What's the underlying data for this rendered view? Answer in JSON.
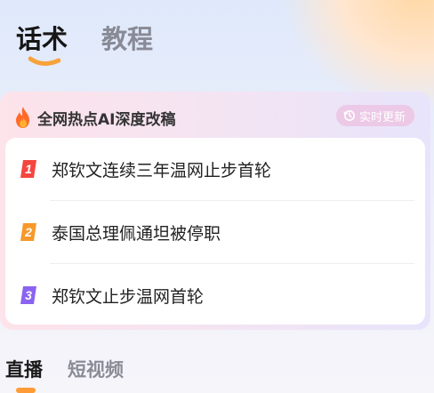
{
  "top_tabs": [
    {
      "label": "话术",
      "active": true
    },
    {
      "label": "教程",
      "active": false
    }
  ],
  "hot_card": {
    "title": "全网热点AI深度改稿",
    "realtime_label": "实时更新",
    "items": [
      {
        "rank": "1",
        "text": "郑钦文连续三年温网止步首轮",
        "color": "#f4463f"
      },
      {
        "rank": "2",
        "text": "泰国总理佩通坦被停职",
        "color": "#f7982b"
      },
      {
        "rank": "3",
        "text": "郑钦文止步温网首轮",
        "color": "#8a63f0"
      }
    ]
  },
  "bottom_tabs": [
    {
      "label": "直播",
      "active": true
    },
    {
      "label": "短视频",
      "active": false
    }
  ],
  "colors": {
    "indicator": "#ff9c38",
    "flame": "#ff6a2b"
  }
}
